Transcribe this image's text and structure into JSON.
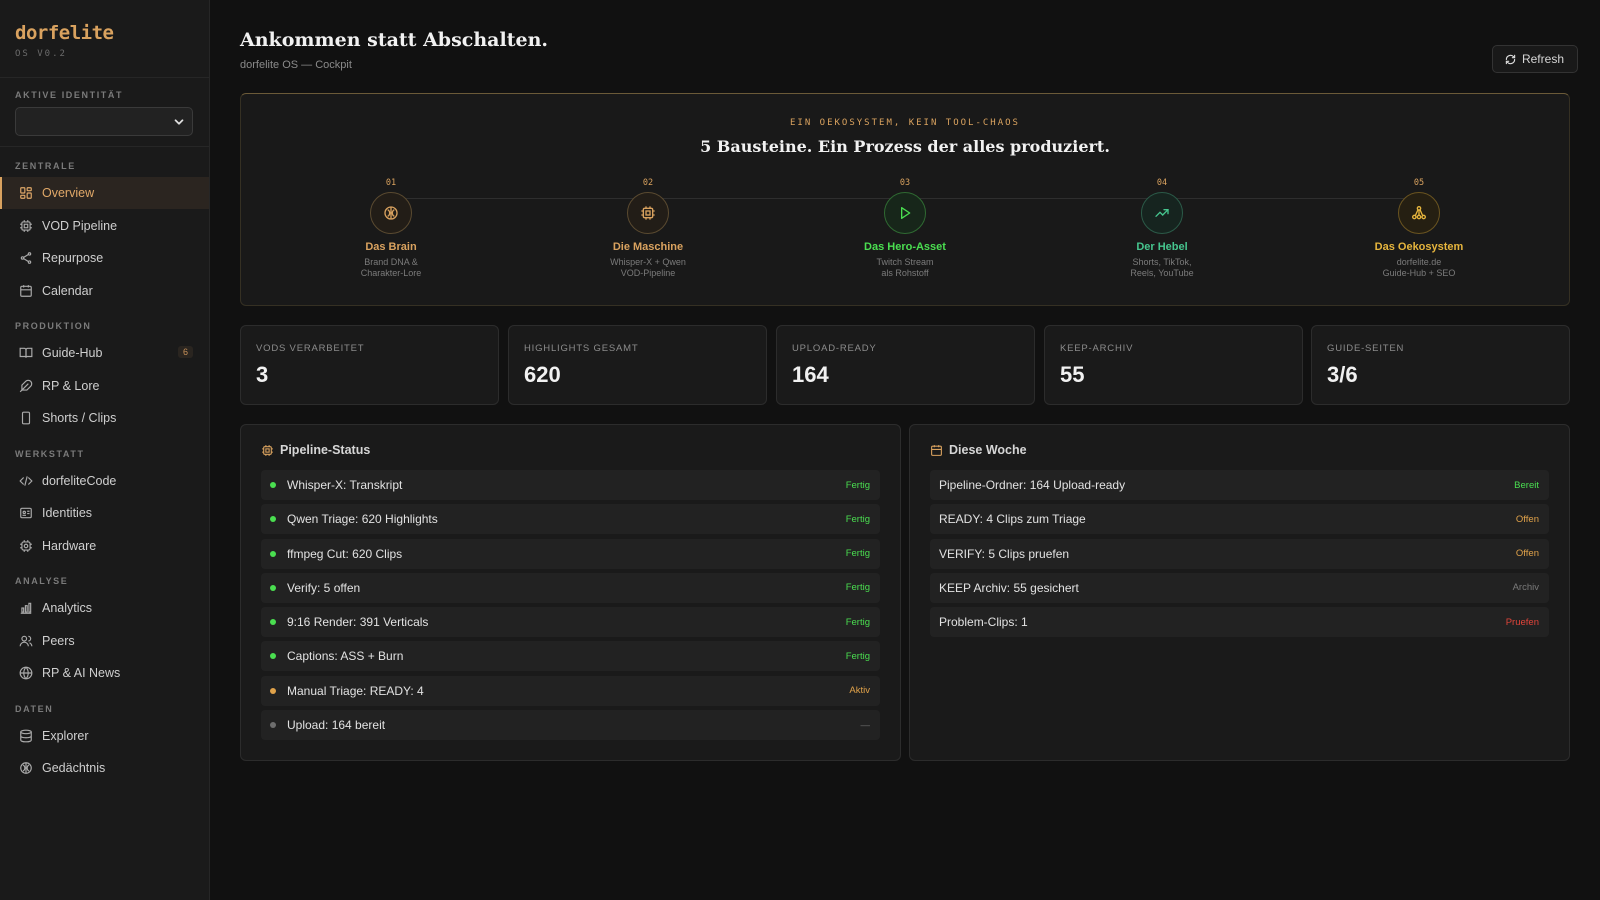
{
  "brand": {
    "name": "dorfelite",
    "version": "OS V0.2"
  },
  "identity": {
    "label": "AKTIVE IDENTITÄT",
    "value": ""
  },
  "nav": [
    {
      "label": "ZENTRALE",
      "items": [
        {
          "label": "Overview",
          "icon": "grid-icon",
          "active": true
        },
        {
          "label": "VOD Pipeline",
          "icon": "chip-icon"
        },
        {
          "label": "Repurpose",
          "icon": "share-icon"
        },
        {
          "label": "Calendar",
          "icon": "calendar-icon"
        }
      ]
    },
    {
      "label": "PRODUKTION",
      "items": [
        {
          "label": "Guide-Hub",
          "icon": "book-icon",
          "badge": "6"
        },
        {
          "label": "RP & Lore",
          "icon": "feather-icon"
        },
        {
          "label": "Shorts / Clips",
          "icon": "phone-icon"
        }
      ]
    },
    {
      "label": "WERKSTATT",
      "items": [
        {
          "label": "dorfeliteCode",
          "icon": "code-icon"
        },
        {
          "label": "Identities",
          "icon": "id-card-icon"
        },
        {
          "label": "Hardware",
          "icon": "cpu-icon"
        }
      ]
    },
    {
      "label": "ANALYSE",
      "items": [
        {
          "label": "Analytics",
          "icon": "bar-chart-icon"
        },
        {
          "label": "Peers",
          "icon": "users-icon"
        },
        {
          "label": "RP & AI News",
          "icon": "globe-icon"
        }
      ]
    },
    {
      "label": "DATEN",
      "items": [
        {
          "label": "Explorer",
          "icon": "database-icon"
        },
        {
          "label": "Gedächtnis",
          "icon": "brain-icon"
        }
      ]
    }
  ],
  "header": {
    "title": "Ankommen statt Abschalten.",
    "subtitle": "dorfelite OS — Cockpit",
    "refresh_label": "Refresh"
  },
  "hero": {
    "kicker": "EIN OEKOSYSTEM, KEIN TOOL-CHAOS",
    "title": "5 Bausteine. Ein Prozess der alles produziert.",
    "steps": [
      {
        "num": "01",
        "name": "Das Brain",
        "desc1": "Brand DNA &",
        "desc2": "Charakter-Lore",
        "color": "#d9a25f",
        "icon": "brain-icon"
      },
      {
        "num": "02",
        "name": "Die Maschine",
        "desc1": "Whisper-X + Qwen",
        "desc2": "VOD-Pipeline",
        "color": "#d9a25f",
        "icon": "chip-icon"
      },
      {
        "num": "03",
        "name": "Das Hero-Asset",
        "desc1": "Twitch Stream",
        "desc2": "als Rohstoff",
        "color": "#4ade50",
        "icon": "play-icon"
      },
      {
        "num": "04",
        "name": "Der Hebel",
        "desc1": "Shorts, TikTok,",
        "desc2": "Reels, YouTube",
        "color": "#46c58e",
        "icon": "trend-up-icon"
      },
      {
        "num": "05",
        "name": "Das Oekosystem",
        "desc1": "dorfelite.de",
        "desc2": "Guide-Hub + SEO",
        "color": "#e6b53d",
        "icon": "network-icon"
      }
    ]
  },
  "stats": [
    {
      "label": "VODS VERARBEITET",
      "value": "3"
    },
    {
      "label": "HIGHLIGHTS GESAMT",
      "value": "620"
    },
    {
      "label": "UPLOAD-READY",
      "value": "164"
    },
    {
      "label": "KEEP-ARCHIV",
      "value": "55"
    },
    {
      "label": "GUIDE-SEITEN",
      "value": "3/6"
    }
  ],
  "pipeline": {
    "title": "Pipeline-Status",
    "rows": [
      {
        "label": "Whisper-X: Transkript",
        "status": "Fertig",
        "color": "#4ade50"
      },
      {
        "label": "Qwen Triage: 620 Highlights",
        "status": "Fertig",
        "color": "#4ade50"
      },
      {
        "label": "ffmpeg Cut: 620 Clips",
        "status": "Fertig",
        "color": "#4ade50"
      },
      {
        "label": "Verify: 5 offen",
        "status": "Fertig",
        "color": "#4ade50"
      },
      {
        "label": "9:16 Render: 391 Verticals",
        "status": "Fertig",
        "color": "#4ade50"
      },
      {
        "label": "Captions: ASS + Burn",
        "status": "Fertig",
        "color": "#4ade50"
      },
      {
        "label": "Manual Triage: READY: 4",
        "status": "Aktiv",
        "color": "#e0a24a"
      },
      {
        "label": "Upload: 164 bereit",
        "status": "—",
        "color": "#6e6e6e"
      }
    ]
  },
  "week": {
    "title": "Diese Woche",
    "rows": [
      {
        "label": "Pipeline-Ordner: 164 Upload-ready",
        "status": "Bereit",
        "color": "#4ade50"
      },
      {
        "label": "READY: 4 Clips zum Triage",
        "status": "Offen",
        "color": "#e0a24a"
      },
      {
        "label": "VERIFY: 5 Clips pruefen",
        "status": "Offen",
        "color": "#e0a24a"
      },
      {
        "label": "KEEP Archiv: 55 gesichert",
        "status": "Archiv",
        "color": "#7a7a7a"
      },
      {
        "label": "Problem-Clips: 1",
        "status": "Pruefen",
        "color": "#e0443a"
      }
    ]
  }
}
